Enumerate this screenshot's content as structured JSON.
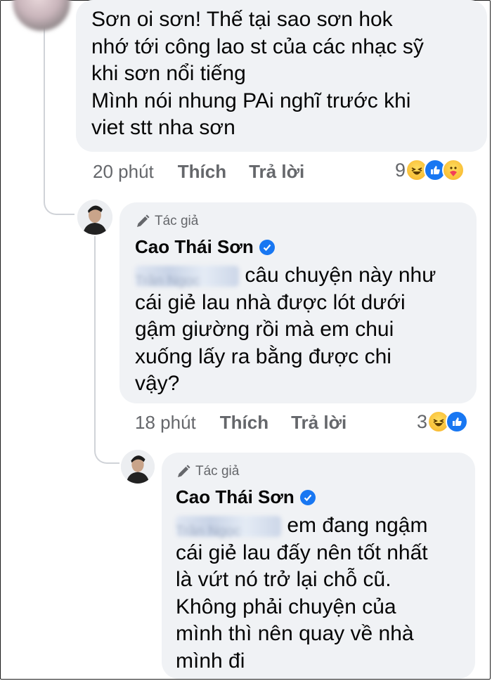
{
  "comments": [
    {
      "text": "Sơn oi sơn! Thế tại sao sơn hok\nnhớ tới công lao st của các nhạc sỹ\nkhi sơn nổi tiếng\nMình nói nhung PAi nghĩ trước khi\nviet stt nha sơn",
      "time": "20 phút",
      "like_label": "Thích",
      "reply_label": "Trả lời",
      "reaction_count": "9",
      "reactions": [
        "haha-icon",
        "like-icon",
        "care-icon"
      ]
    },
    {
      "badge": "Tác giả",
      "author": "Cao Thái Sơn",
      "mention": "Trần Ngọc",
      "text_first": "câu chuyện này như",
      "text_rest": "cái giẻ lau nhà được lót dưới\ngậm giường rồi mà em chui\nxuống lấy ra bằng được chi\nvậy?",
      "time": "18 phút",
      "like_label": "Thích",
      "reply_label": "Trả lời",
      "reaction_count": "3",
      "reactions": [
        "haha-icon",
        "like-icon"
      ]
    },
    {
      "badge": "Tác giả",
      "author": "Cao Thái Sơn",
      "mention": "Trần Ngọc",
      "text_first": "em đang ngậm",
      "text_rest": "cái giẻ lau đấy nên tốt nhất\nlà vứt nó trở lại chỗ cũ.\nKhông phải chuyện của\nmình thì nên quay về nhà\nmình đi"
    }
  ],
  "colors": {
    "bubble": "#f0f2f5",
    "meta_text": "#65676b",
    "verified": "#1877f2",
    "thread_line": "#d0d3d8"
  }
}
